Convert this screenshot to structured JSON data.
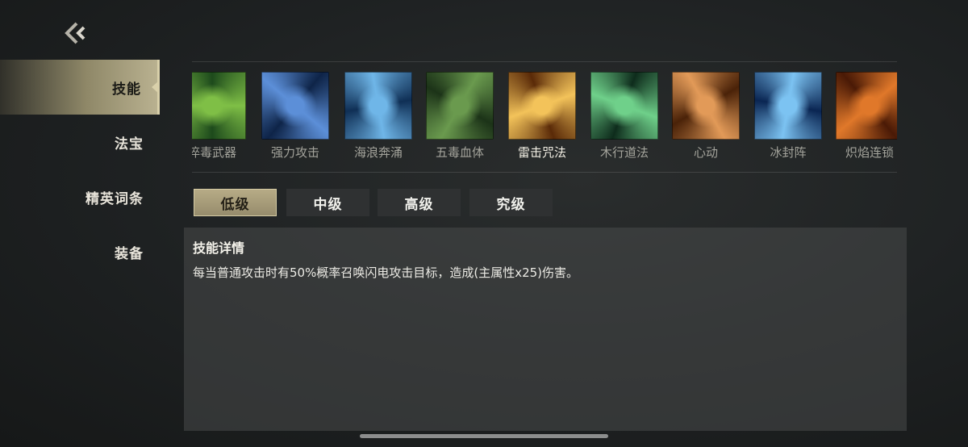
{
  "header": {
    "back_icon": "back-chevron-icon"
  },
  "sidebar": {
    "items": [
      {
        "label": "技能",
        "active": true
      },
      {
        "label": "法宝",
        "active": false
      },
      {
        "label": "精英词条",
        "active": false
      },
      {
        "label": "装备",
        "active": false
      }
    ]
  },
  "skills": [
    {
      "label": "淬毒武器",
      "icon": "poison-blade-icon",
      "colors": [
        "#1d4a1c",
        "#7fbf46"
      ]
    },
    {
      "label": "强力攻击",
      "icon": "lightning-fist-icon",
      "colors": [
        "#0e2448",
        "#5c8fd8"
      ]
    },
    {
      "label": "海浪奔涌",
      "icon": "wave-icon",
      "colors": [
        "#0f2f55",
        "#6fb6e8"
      ]
    },
    {
      "label": "五毒血体",
      "icon": "poison-body-icon",
      "colors": [
        "#1c3318",
        "#6a9a4e"
      ]
    },
    {
      "label": "雷击咒法",
      "icon": "thunder-spell-icon",
      "colors": [
        "#5a2a08",
        "#f3c35a"
      ],
      "selected": true
    },
    {
      "label": "木行道法",
      "icon": "wood-vortex-icon",
      "colors": [
        "#0e2c1c",
        "#6fd08a"
      ]
    },
    {
      "label": "心动",
      "icon": "heart-swirl-icon",
      "colors": [
        "#4a2208",
        "#e29a58"
      ]
    },
    {
      "label": "冰封阵",
      "icon": "ice-vortex-icon",
      "colors": [
        "#0a2552",
        "#7cc3f2"
      ]
    },
    {
      "label": "炽焰连锁",
      "icon": "flame-demon-icon",
      "colors": [
        "#4a1a06",
        "#e0782a"
      ]
    }
  ],
  "tabs": [
    {
      "label": "低级",
      "active": true
    },
    {
      "label": "中级",
      "active": false
    },
    {
      "label": "高级",
      "active": false
    },
    {
      "label": "究级",
      "active": false
    }
  ],
  "detail": {
    "title": "技能详情",
    "text": "每当普通攻击时有50%概率召唤闪电攻击目标，造成(主属性x25)伤害。"
  }
}
